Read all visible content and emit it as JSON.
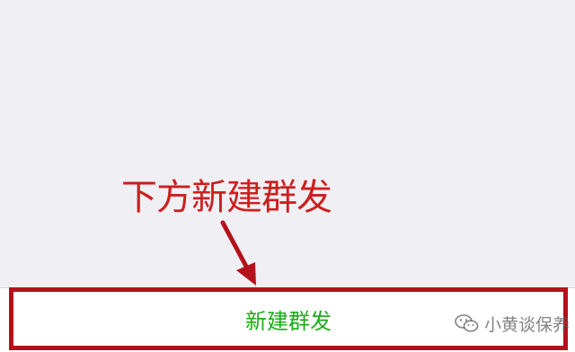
{
  "annotation": {
    "label": "下方新建群发",
    "color": "#cc1f1f"
  },
  "bottom_bar": {
    "button_label": "新建群发",
    "button_color": "#1aad19",
    "frame_color": "#b3121a"
  },
  "watermark": {
    "icon": "wechat-icon",
    "text": "小黄谈保养"
  }
}
